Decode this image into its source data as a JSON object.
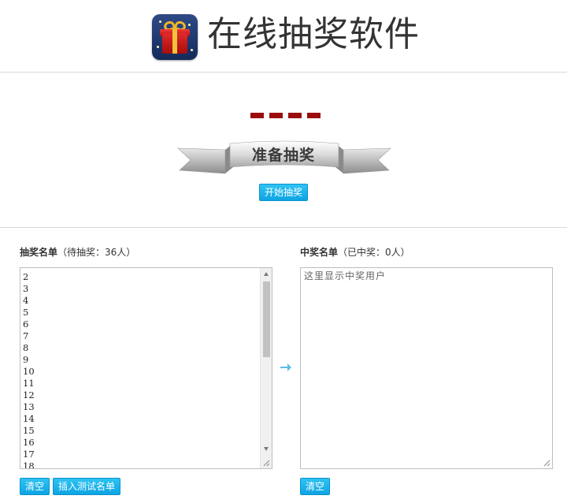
{
  "header": {
    "title": "在线抽奖软件"
  },
  "lottery": {
    "status_banner": "准备抽奖",
    "dash_count": 4,
    "start_button": "开始抽奖"
  },
  "candidates": {
    "label_bold": "抽奖名单",
    "label_info": "（待抽奖：36人）",
    "names": [
      "2",
      "3",
      "4",
      "5",
      "6",
      "7",
      "8",
      "9",
      "10",
      "11",
      "12",
      "13",
      "14",
      "15",
      "16",
      "17",
      "18"
    ],
    "clear_button": "清空",
    "insert_button": "插入测试名单"
  },
  "winners": {
    "label_bold": "中奖名单",
    "label_info": "（已中奖：0人）",
    "placeholder": "这里显示中奖用户",
    "clear_button": "清空"
  },
  "colors": {
    "accent_button": "#0ea4e3",
    "dash": "#9b0d0d",
    "arrow": "#5bbde6"
  },
  "icons": {
    "logo": "gift-box-icon",
    "transfer": "arrow-right-icon"
  }
}
